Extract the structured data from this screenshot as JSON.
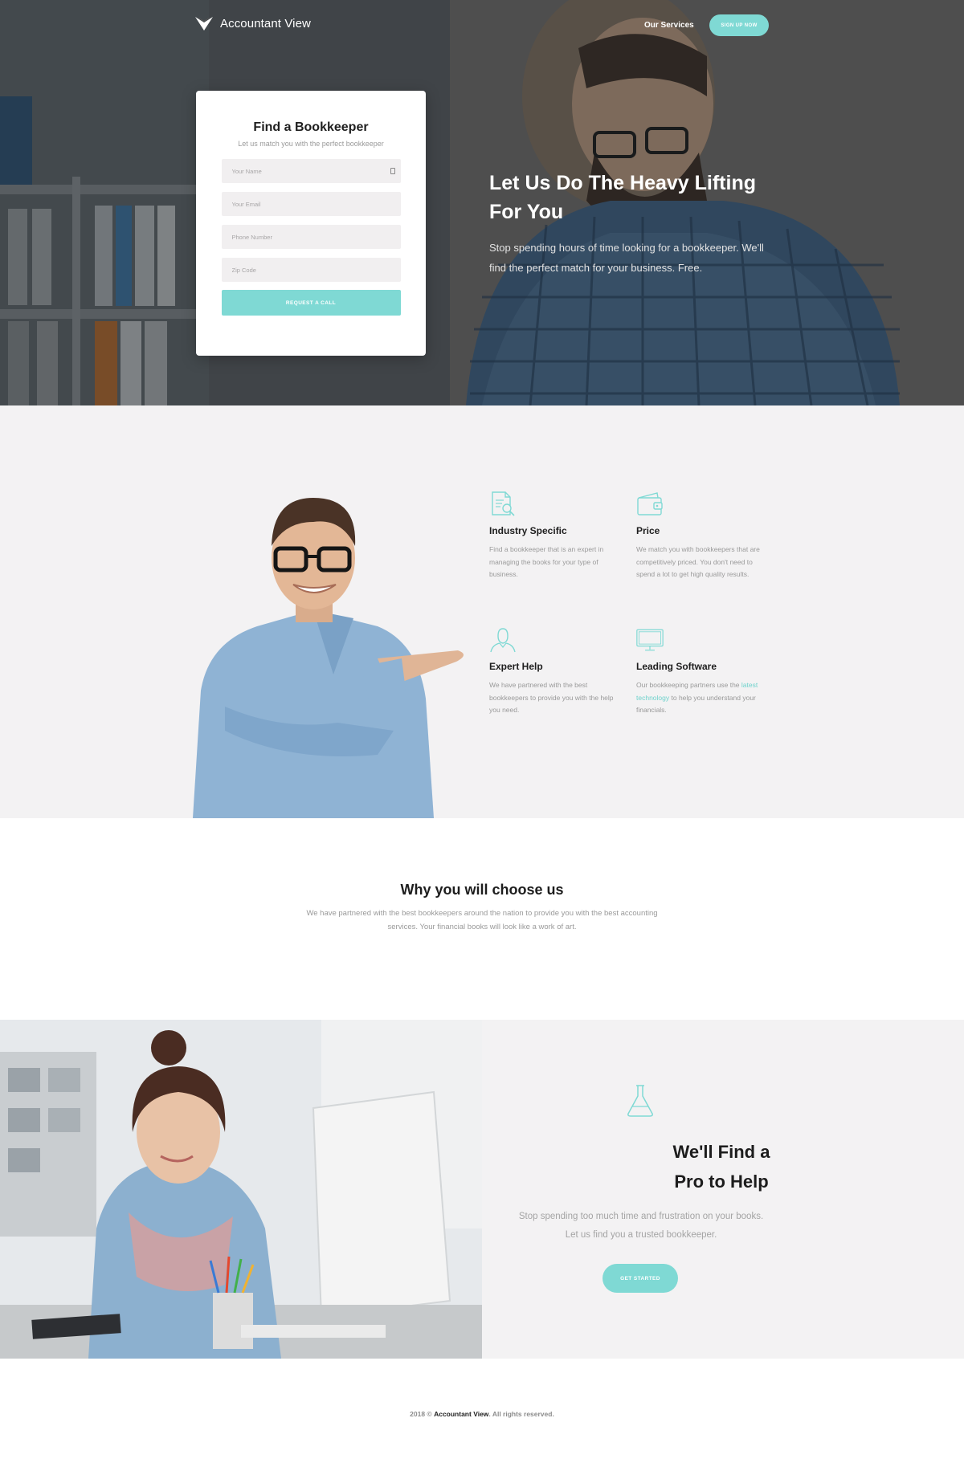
{
  "brand": {
    "name": "Accountant View"
  },
  "nav": {
    "services": "Our Services",
    "signup": "SIGN UP NOW"
  },
  "form": {
    "title": "Find a Bookkeeper",
    "subtitle": "Let us match you with the perfect bookkeeper",
    "name_placeholder": "Your Name",
    "email_placeholder": "Your Email",
    "phone_placeholder": "Phone Number",
    "zip_placeholder": "Zip Code",
    "submit": "REQUEST A CALL"
  },
  "hero": {
    "title": "Let Us Do The Heavy Lifting For You",
    "text": "Stop spending hours of time looking for a bookkeeper. We'll find the perfect match for your business. Free."
  },
  "features": [
    {
      "icon": "document-search-icon",
      "title": "Industry Specific",
      "text": "Find a bookkeeper that is an expert in managing the books for your type of business."
    },
    {
      "icon": "wallet-icon",
      "title": "Price",
      "text": "We match you with bookkeepers that are competitively priced. You don't need to spend a lot to get high quality results."
    },
    {
      "icon": "user-icon",
      "title": "Expert Help",
      "text": "We have partnered with the best bookkeepers to provide you with the help you need."
    },
    {
      "icon": "monitor-icon",
      "title": "Leading Software",
      "text_before": "Our bookkeeping partners use the",
      "link": "latest technology",
      "text_after": "to help you understand your financials."
    }
  ],
  "why": {
    "title": "Why you will choose us",
    "text": "We have partnered with the best bookkeepers around the nation to provide you with the best accounting services. Your financial books will look like a work of art."
  },
  "pro": {
    "icon": "flask-icon",
    "title_line1": "We'll Find a",
    "title_line2": "Pro to Help",
    "text": "Stop spending too much time and frustration on your books. Let us find you a trusted bookkeeper.",
    "button": "GET STARTED"
  },
  "footer": {
    "year": "2018 ©",
    "brand": "Accountant View",
    "rights": ". All rights reserved."
  },
  "colors": {
    "accent": "#7fd9d4",
    "muted": "#9a9a9a",
    "panel": "#f3f2f3"
  }
}
